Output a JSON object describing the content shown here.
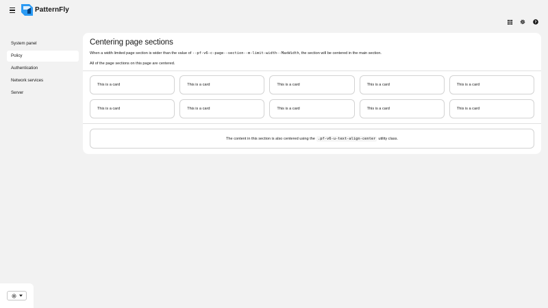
{
  "masthead": {
    "brand": "PatternFly",
    "tools": [
      "grid-icon",
      "gear-icon",
      "help-icon"
    ]
  },
  "sidebar": {
    "items": [
      {
        "label": "System panel",
        "active": false
      },
      {
        "label": "Policy",
        "active": true
      },
      {
        "label": "Authentication",
        "active": false
      },
      {
        "label": "Network services",
        "active": false
      },
      {
        "label": "Server",
        "active": false
      }
    ]
  },
  "main": {
    "title": "Centering page sections",
    "paragraph1": {
      "before": "When a width limited page section is wider than the value of ",
      "code": "--pf-v6-c-page--section--m-limit-width--MaxWidth",
      "after": ", the section will be centered in the main section."
    },
    "paragraph2": "All of the page sections on this page are centered.",
    "cards": [
      "This is a card",
      "This is a card",
      "This is a card",
      "This is a card",
      "This is a card",
      "This is a card",
      "This is a card",
      "This is a card",
      "This is a card",
      "This is a card"
    ],
    "centered": {
      "before": "The content in this section is also centered using the ",
      "code": ".pf-v6-u-text-align-center",
      "after": " utility class."
    }
  },
  "colors": {
    "background": "#f2f2f2",
    "surface": "#ffffff",
    "logo_blue": "#2b9af3",
    "logo_dark": "#004080"
  }
}
